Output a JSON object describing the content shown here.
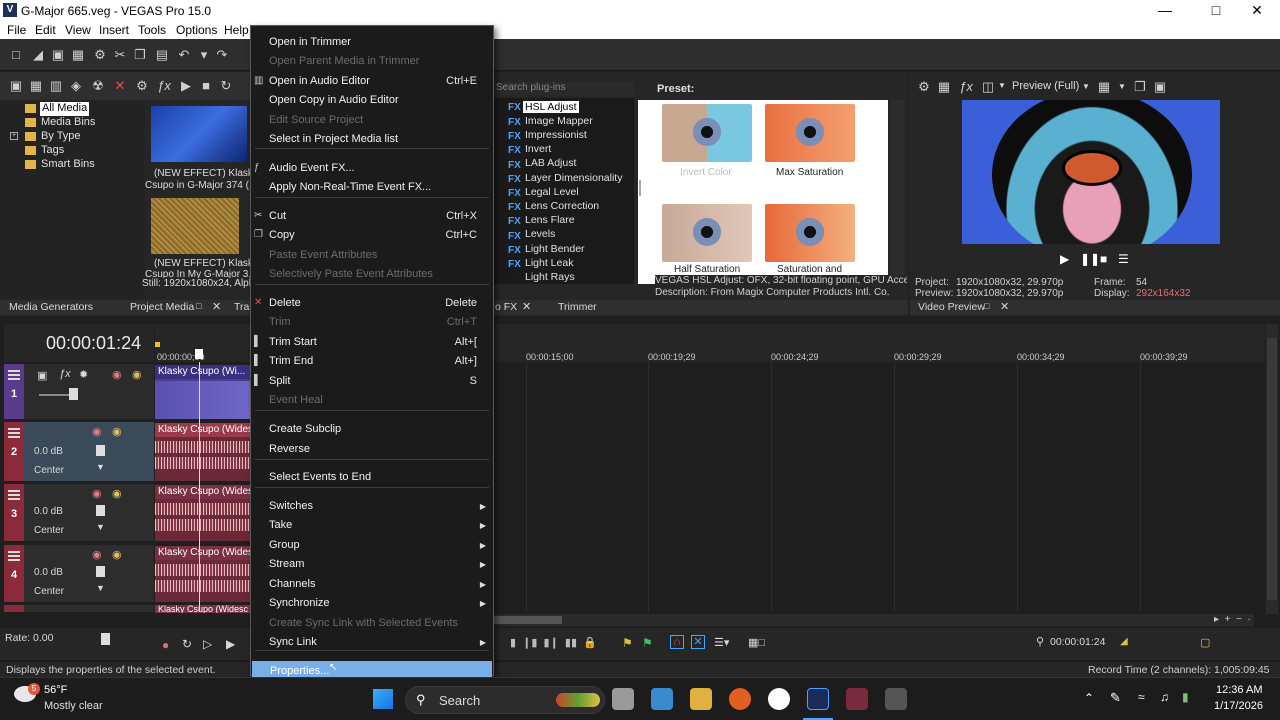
{
  "window": {
    "title": "G-Major 665.veg - VEGAS Pro 15.0",
    "app_icon": "V"
  },
  "menubar": [
    "File",
    "Edit",
    "View",
    "Insert",
    "Tools",
    "Options",
    "Help"
  ],
  "media_tree": [
    "All Media",
    "Media Bins",
    "By Type",
    "Tags",
    "Smart Bins"
  ],
  "media_items": [
    {
      "label1": "(NEW EFFECT) Klasky",
      "label2": "Csupo in G-Major 374 (..."
    },
    {
      "label1": "(NEW EFFECT) Klasky",
      "label2": "Csupo In My G-Major 3..."
    }
  ],
  "media_still": "Still: 1920x1080x24, Alph",
  "left_tabs": [
    "Media Generators",
    "Project Media",
    "Tra"
  ],
  "plugin_search_placeholder": "Search plug-ins",
  "plugins": [
    "HSL Adjust",
    "Image Mapper",
    "Impressionist",
    "Invert",
    "LAB Adjust",
    "Layer Dimensionality",
    "Legal Level",
    "Lens Correction",
    "Lens Flare",
    "Levels",
    "Light Bender",
    "Light Leak",
    "Light Rays"
  ],
  "fx_tag": "FX",
  "preset": {
    "label": "Preset:",
    "items": [
      "Invert Color",
      "Max Saturation",
      "Half Saturation",
      "Saturation and"
    ]
  },
  "fx_desc": [
    "VEGAS HSL Adjust: OFX, 32-bit floating point, GPU Acceler",
    "Description: From Magix Computer Products Intl. Co."
  ],
  "fx_tabs": [
    "o FX",
    "Trimmer"
  ],
  "preview": {
    "mode": "Preview (Full)",
    "project_label": "Project:",
    "project_val": "1920x1080x32, 29.970p",
    "preview_label": "Preview:",
    "preview_val": "1920x1080x32, 29.970p",
    "frame_label": "Frame:",
    "frame_val": "54",
    "display_label": "Display:",
    "display_val": "292x164x32",
    "tab": "Video Preview"
  },
  "timecode": "00:00:01:24",
  "ruler": [
    "00:00:00;00",
    "00:00:15;00",
    "00:00:19;29",
    "00:00:24;29",
    "00:00:29;29",
    "00:00:34;29",
    "00:00:39;29"
  ],
  "tracks": [
    {
      "num": "1",
      "clip": "Klasky Csupo (Wi..."
    },
    {
      "num": "2",
      "db": "0.0 dB",
      "pan": "Center",
      "clip": "Klasky Csupo (Widesc"
    },
    {
      "num": "3",
      "db": "0.0 dB",
      "pan": "Center",
      "clip": "Klasky Csupo (Widesc"
    },
    {
      "num": "4",
      "db": "0.0 dB",
      "pan": "Center",
      "clip": "Klasky Csupo (Widesc"
    },
    {
      "num": "5",
      "clip": "Klasky Csupo (Widesc"
    }
  ],
  "rate": "Rate: 0.00",
  "bottom_time": "00:00:01:24",
  "context_menu": [
    {
      "label": "Open in Trimmer",
      "shortcut": "",
      "disabled": false,
      "icon": ""
    },
    {
      "label": "Open Parent Media in Trimmer",
      "shortcut": "",
      "disabled": true,
      "icon": ""
    },
    {
      "label": "Open in Audio Editor",
      "shortcut": "Ctrl+E",
      "disabled": false,
      "icon": "▥"
    },
    {
      "label": "Open Copy in Audio Editor",
      "shortcut": "",
      "disabled": false,
      "icon": ""
    },
    {
      "label": "Edit Source Project",
      "shortcut": "",
      "disabled": true,
      "icon": ""
    },
    {
      "label": "Select in Project Media list",
      "shortcut": "",
      "disabled": false,
      "icon": ""
    },
    {
      "label": "Audio Event FX...",
      "shortcut": "",
      "disabled": false,
      "icon": "ƒ"
    },
    {
      "label": "Apply Non-Real-Time Event FX...",
      "shortcut": "",
      "disabled": false,
      "icon": ""
    },
    {
      "label": "Cut",
      "shortcut": "Ctrl+X",
      "disabled": false,
      "icon": "✂"
    },
    {
      "label": "Copy",
      "shortcut": "Ctrl+C",
      "disabled": false,
      "icon": "❐"
    },
    {
      "label": "Paste Event Attributes",
      "shortcut": "",
      "disabled": true,
      "icon": ""
    },
    {
      "label": "Selectively Paste Event Attributes",
      "shortcut": "",
      "disabled": true,
      "icon": ""
    },
    {
      "label": "Delete",
      "shortcut": "Delete",
      "disabled": false,
      "icon": "✕"
    },
    {
      "label": "Trim",
      "shortcut": "Ctrl+T",
      "disabled": true,
      "icon": ""
    },
    {
      "label": "Trim Start",
      "shortcut": "Alt+[",
      "disabled": false,
      "icon": "▌"
    },
    {
      "label": "Trim End",
      "shortcut": "Alt+]",
      "disabled": false,
      "icon": "▌"
    },
    {
      "label": "Split",
      "shortcut": "S",
      "disabled": false,
      "icon": "▌"
    },
    {
      "label": "Event Heal",
      "shortcut": "",
      "disabled": true,
      "icon": ""
    },
    {
      "label": "Create Subclip",
      "shortcut": "",
      "disabled": false,
      "icon": ""
    },
    {
      "label": "Reverse",
      "shortcut": "",
      "disabled": false,
      "icon": ""
    },
    {
      "label": "Select Events to End",
      "shortcut": "",
      "disabled": false,
      "icon": ""
    },
    {
      "label": "Switches",
      "shortcut": "",
      "disabled": false,
      "icon": "",
      "sub": true
    },
    {
      "label": "Take",
      "shortcut": "",
      "disabled": false,
      "icon": "",
      "sub": true
    },
    {
      "label": "Group",
      "shortcut": "",
      "disabled": false,
      "icon": "",
      "sub": true
    },
    {
      "label": "Stream",
      "shortcut": "",
      "disabled": false,
      "icon": "",
      "sub": true
    },
    {
      "label": "Channels",
      "shortcut": "",
      "disabled": false,
      "icon": "",
      "sub": true
    },
    {
      "label": "Synchronize",
      "shortcut": "",
      "disabled": false,
      "icon": "",
      "sub": true
    },
    {
      "label": "Create Sync Link with Selected Events",
      "shortcut": "",
      "disabled": true,
      "icon": ""
    },
    {
      "label": "Sync Link",
      "shortcut": "",
      "disabled": false,
      "icon": "",
      "sub": true
    },
    {
      "label": "Properties...",
      "shortcut": "",
      "disabled": false,
      "icon": "",
      "highlight": true
    }
  ],
  "status": {
    "left": "Displays the properties of the selected event.",
    "right": "Record Time (2 channels): 1,005:09:45"
  },
  "taskbar": {
    "temp": "56°F",
    "weather": "Mostly clear",
    "badge": "5",
    "search": "Search",
    "time": "12:36 AM",
    "date": "1/17/2026"
  }
}
